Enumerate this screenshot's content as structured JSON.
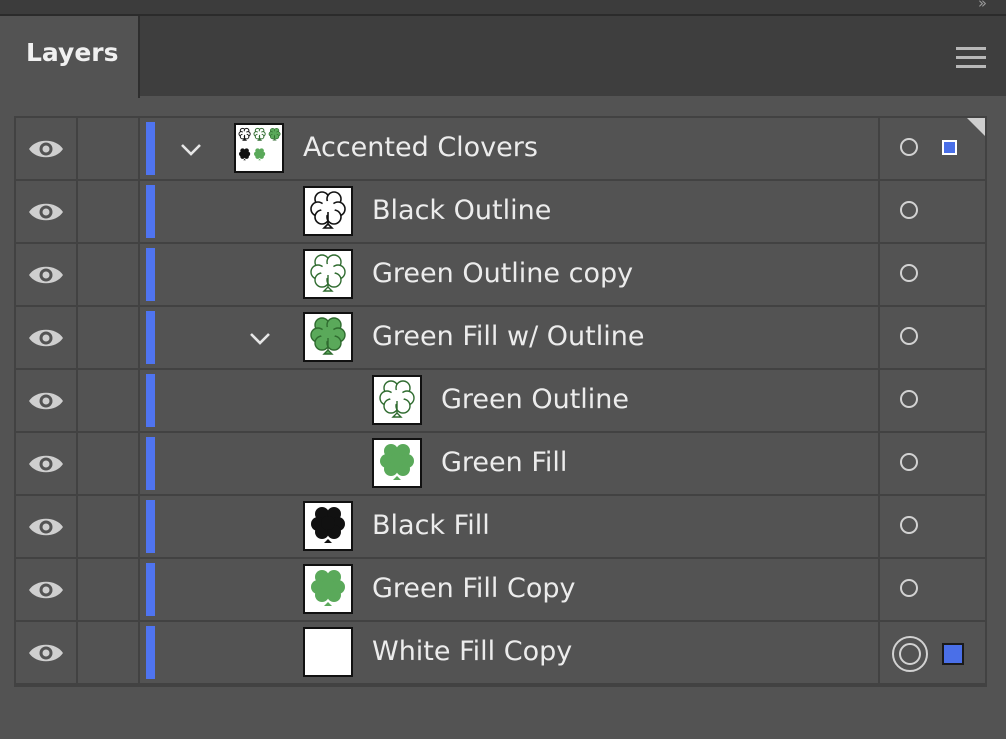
{
  "panel": {
    "tab_label": "Layers",
    "collapse_icon": "double-chevron-right-icon",
    "menu_icon": "hamburger-menu-icon"
  },
  "colors": {
    "layer_color": "#4f74f0",
    "panel_bg": "#535353",
    "green": "#5aa95a",
    "green_dark": "#2f6b2f"
  },
  "layers": [
    {
      "name": "Accented Clovers",
      "visible": true,
      "expanded": true,
      "level": 0,
      "thumb": "group",
      "target": "circle",
      "selected": "small"
    },
    {
      "name": "Black Outline",
      "visible": true,
      "level": 1,
      "thumb": "black-outline",
      "target": "circle"
    },
    {
      "name": "Green Outline copy",
      "visible": true,
      "level": 1,
      "thumb": "green-outline",
      "target": "circle"
    },
    {
      "name": "Green Fill w/ Outline",
      "visible": true,
      "expanded": true,
      "level": 1,
      "thumb": "green-fill-outline",
      "target": "circle"
    },
    {
      "name": "Green Outline",
      "visible": true,
      "level": 2,
      "thumb": "green-outline",
      "target": "circle"
    },
    {
      "name": "Green Fill",
      "visible": true,
      "level": 2,
      "thumb": "green-fill",
      "target": "circle"
    },
    {
      "name": "Black Fill",
      "visible": true,
      "level": 1,
      "thumb": "black-fill",
      "target": "circle"
    },
    {
      "name": "Green Fill Copy",
      "visible": true,
      "level": 1,
      "thumb": "green-fill",
      "target": "circle"
    },
    {
      "name": "White Fill Copy",
      "visible": true,
      "level": 1,
      "thumb": "white",
      "target": "double-circle",
      "selected": "large"
    }
  ]
}
